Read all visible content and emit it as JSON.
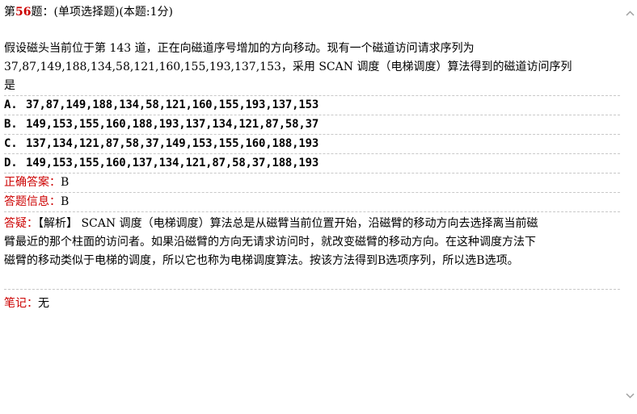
{
  "question": {
    "prefix": "第",
    "number": "56",
    "suffix": "题：(单项选择题)(本题:1分)",
    "stem_lines": [
      "假设磁头当前位于第 143 道，正在向磁道序号增加的方向移动。现有一个磁道访问请求序列为",
      "37,87,149,188,134,58,121,160,155,193,137,153，采用 SCAN 调度（电梯调度）算法得到的磁道访问序列",
      "是"
    ]
  },
  "options": [
    {
      "letter": "A.",
      "text": "37,87,149,188,134,58,121,160,155,193,137,153"
    },
    {
      "letter": "B.",
      "text": "149,153,155,160,188,193,137,134,121,87,58,37"
    },
    {
      "letter": "C.",
      "text": "137,134,121,87,58,37,149,153,155,160,188,193"
    },
    {
      "letter": "D.",
      "text": "149,153,155,160,137,134,121,87,58,37,188,193"
    }
  ],
  "answer": {
    "label": "正确答案：",
    "value": "B"
  },
  "response": {
    "label": "答题信息：",
    "value": "B"
  },
  "analysis": {
    "label": "答疑：",
    "lines": [
      "【解析】 SCAN 调度（电梯调度）算法总是从磁臂当前位置开始，沿磁臂的移动方向去选择离当前磁",
      "臂最近的那个柱面的访问者。如果沿磁臂的方向无请求访问时，就改变磁臂的移动方向。在这种调度方法下",
      "磁臂的移动类似于电梯的调度，所以它也称为电梯调度算法。按该方法得到B选项序列，所以选B选项。"
    ]
  },
  "note": {
    "label": "笔记：",
    "value": "无"
  },
  "scrollbar": {
    "up_icon": "chevron-up-icon",
    "down_icon": "chevron-down-icon"
  }
}
